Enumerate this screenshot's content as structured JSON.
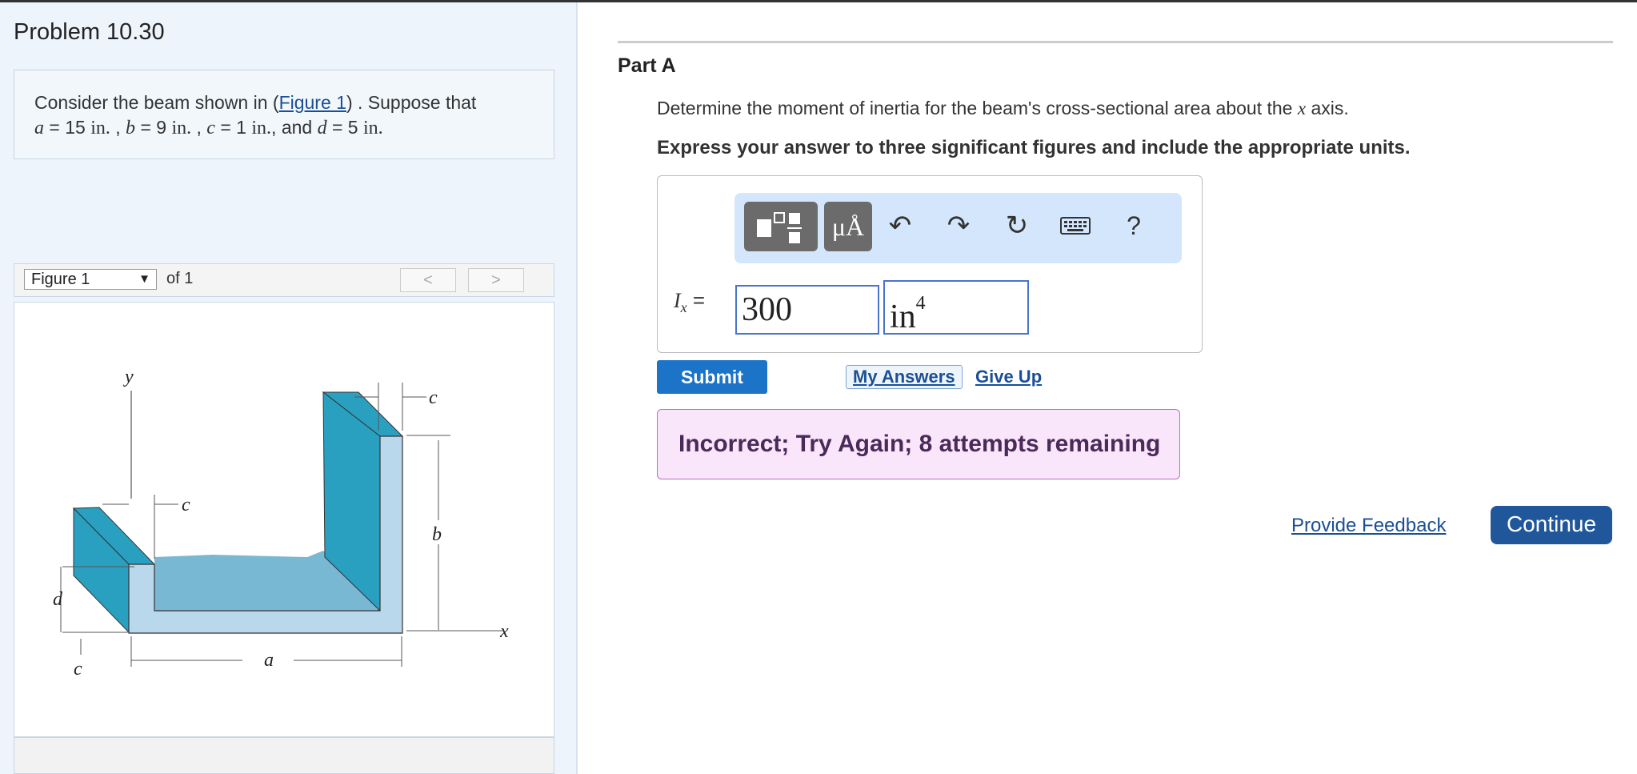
{
  "problem": {
    "title": "Problem 10.30",
    "intro_prefix": "Consider the beam shown in (",
    "figure_link": "Figure 1",
    "intro_suffix": ") . Suppose that",
    "var_a": "a",
    "var_b": "b",
    "var_c": "c",
    "var_d": "d",
    "val_a": "15",
    "val_b": "9",
    "val_c": "1",
    "val_d": "5",
    "unit": "in.",
    "unit_d": "in.",
    "equals": "=",
    "sep": ",",
    "and": "and"
  },
  "figure": {
    "select_label": "Figure 1",
    "of_label": "of 1",
    "prev": "<",
    "next": ">",
    "labels": {
      "y": "y",
      "x": "x",
      "a": "a",
      "b": "b",
      "c": "c",
      "d": "d"
    }
  },
  "part": {
    "title": "Part A",
    "question_prefix": "Determine the moment of inertia for the beam's cross-sectional area about the",
    "question_var": "x",
    "question_suffix": "axis.",
    "instruction": "Express your answer to three significant figures and include the appropriate units."
  },
  "answer": {
    "label_main": "I",
    "label_sub": "x",
    "label_eq": "=",
    "value": "300",
    "unit": "in",
    "unit_exp": "4"
  },
  "toolbar": {
    "units_label": "μÅ",
    "help": "?"
  },
  "actions": {
    "submit": "Submit",
    "my_answers": "My Answers",
    "give_up": "Give Up"
  },
  "feedback": {
    "message": "Incorrect; Try Again; 8 attempts remaining"
  },
  "footer": {
    "provide_feedback": "Provide Feedback",
    "continue": "Continue"
  },
  "colors": {
    "accent": "#1c74c9",
    "continue_bg": "#20579b",
    "feedback_bg": "#fae6fb",
    "beam_dark": "#2aa0c1",
    "beam_light": "#b9d8ec"
  }
}
